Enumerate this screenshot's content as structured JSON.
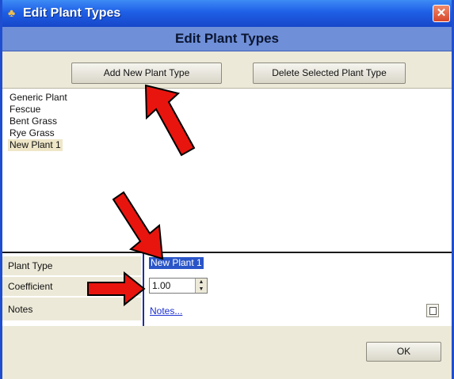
{
  "window": {
    "title": "Edit Plant Types",
    "close_glyph": "✕",
    "app_icon": "plant-app-icon"
  },
  "header": {
    "title": "Edit Plant Types"
  },
  "toolbar": {
    "add_label": "Add New Plant Type",
    "delete_label": "Delete Selected Plant Type"
  },
  "plant_list": {
    "items": [
      "Generic Plant",
      "Fescue",
      "Bent Grass",
      "Rye Grass",
      "New Plant 1"
    ],
    "selected": "New Plant 1"
  },
  "properties": {
    "plant_type_label": "Plant Type",
    "plant_type_value": "New Plant 1",
    "coefficient_label": "Coefficient",
    "coefficient_value": "1.00",
    "notes_label": "Notes",
    "notes_link": "Notes..."
  },
  "footer": {
    "ok_label": "OK"
  },
  "colors": {
    "title_bar": "#1e5fe6",
    "header_band": "#6f8fd8",
    "selection": "#2a55c8",
    "annotation_arrow": "#e8150e"
  }
}
